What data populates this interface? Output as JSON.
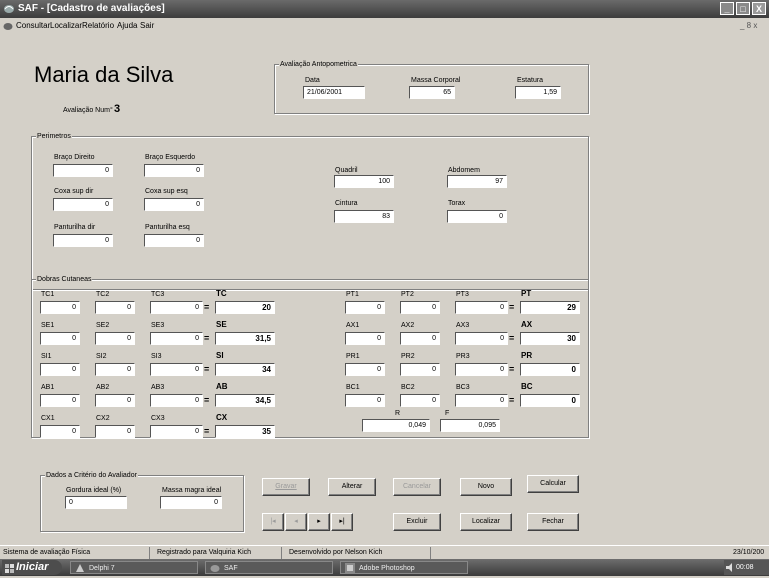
{
  "window": {
    "title": "SAF - [Cadastro de avaliações]",
    "controls": [
      "_",
      "□",
      "X"
    ],
    "child_controls": "_ 8 x"
  },
  "menu": {
    "items": [
      "Consultar",
      "Localizar",
      "Relatório",
      "Ajuda",
      "Sair"
    ]
  },
  "header": {
    "name": "Maria da Silva",
    "eval_label": "Avaliação Num°",
    "eval_num": "3"
  },
  "antropometrica": {
    "title": "Avaliação Antopometrica",
    "data_label": "Data",
    "data_value": "21/06/2001",
    "massa_label": "Massa Corporal",
    "massa_value": "65",
    "estatura_label": "Estatura",
    "estatura_value": "1,59"
  },
  "perimetros": {
    "title": "Perimetros",
    "fields": [
      {
        "label": "Braço Direito",
        "value": "0"
      },
      {
        "label": "Braço Esquerdo",
        "value": "0"
      },
      {
        "label": "Coxa sup dir",
        "value": "0"
      },
      {
        "label": "Coxa sup esq",
        "value": "0"
      },
      {
        "label": "Panturilha dir",
        "value": "0"
      },
      {
        "label": "Panturilha esq",
        "value": "0"
      },
      {
        "label": "Quadril",
        "value": "100"
      },
      {
        "label": "Abdomem",
        "value": "97"
      },
      {
        "label": "Cintura",
        "value": "83"
      },
      {
        "label": "Torax",
        "value": "0"
      }
    ]
  },
  "dobras": {
    "title": "Dobras Cutaneas",
    "left": [
      {
        "l1": "TC1",
        "l2": "TC2",
        "l3": "TC3",
        "total": "TC",
        "v1": "0",
        "v2": "0",
        "v3": "0",
        "t": "20"
      },
      {
        "l1": "SE1",
        "l2": "SE2",
        "l3": "SE3",
        "total": "SE",
        "v1": "0",
        "v2": "0",
        "v3": "0",
        "t": "31,5"
      },
      {
        "l1": "SI1",
        "l2": "SI2",
        "l3": "SI3",
        "total": "SI",
        "v1": "0",
        "v2": "0",
        "v3": "0",
        "t": "34"
      },
      {
        "l1": "AB1",
        "l2": "AB2",
        "l3": "AB3",
        "total": "AB",
        "v1": "0",
        "v2": "0",
        "v3": "0",
        "t": "34,5"
      },
      {
        "l1": "CX1",
        "l2": "CX2",
        "l3": "CX3",
        "total": "CX",
        "v1": "0",
        "v2": "0",
        "v3": "0",
        "t": "35"
      }
    ],
    "right": [
      {
        "l1": "PT1",
        "l2": "PT2",
        "l3": "PT3",
        "total": "PT",
        "v1": "0",
        "v2": "0",
        "v3": "0",
        "t": "29"
      },
      {
        "l1": "AX1",
        "l2": "AX2",
        "l3": "AX3",
        "total": "AX",
        "v1": "0",
        "v2": "0",
        "v3": "0",
        "t": "30"
      },
      {
        "l1": "PR1",
        "l2": "PR2",
        "l3": "PR3",
        "total": "PR",
        "v1": "0",
        "v2": "0",
        "v3": "0",
        "t": "0"
      },
      {
        "l1": "BC1",
        "l2": "BC2",
        "l3": "BC3",
        "total": "BC",
        "v1": "0",
        "v2": "0",
        "v3": "0",
        "t": "0"
      }
    ],
    "eq": "=",
    "r_label": "R",
    "r_value": "0,049",
    "f_label": "F",
    "f_value": "0,095"
  },
  "criterio": {
    "title": "Dados a Critério do Avaliador",
    "gordura_label": "Gordura ideal (%)",
    "gordura_value": "0",
    "massa_label": "Massa magra ideal",
    "massa_value": "0"
  },
  "buttons": {
    "gravar": "Gravar",
    "alterar": "Alterar",
    "cancelar": "Cancelar",
    "novo": "Novo",
    "calcular": "Calcular",
    "first": "|◂",
    "prev": "◂",
    "next": "▸",
    "last": "▸|",
    "excluir": "Excluir",
    "localizar": "Localizar",
    "fechar": "Fechar"
  },
  "status": {
    "p1": "Sistema de avaliação Física",
    "p2": "Registrado para Valquiria Kich",
    "p3": "Desenvolvido por Nelson Kich",
    "date": "23/10/200"
  },
  "taskbar": {
    "start": "Iniciar",
    "items": [
      "Delphi 7",
      "SAF",
      "Adobe Photoshop"
    ],
    "clock": "00:08"
  },
  "colors": {
    "title_bar": "#4a4a4a",
    "face": "#d4d0c8",
    "taskbar": "#505050"
  }
}
